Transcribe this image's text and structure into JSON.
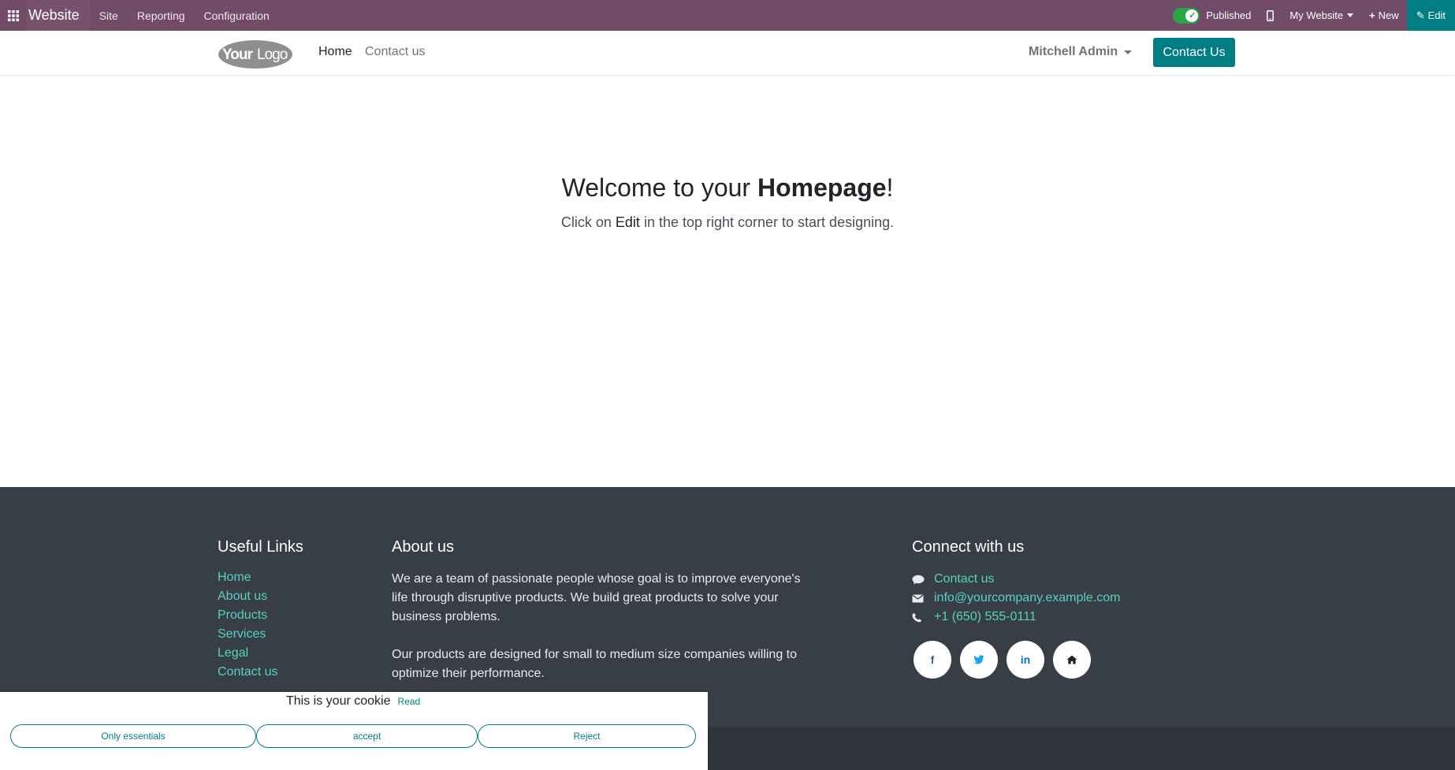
{
  "topbar": {
    "app_name": "Website",
    "menu": [
      "Site",
      "Reporting",
      "Configuration"
    ],
    "published_label": "Published",
    "website_label": "My Website",
    "new_label": "New",
    "edit_label": "Edit"
  },
  "header": {
    "logo_text": "YourLogo",
    "nav": [
      "Home",
      "Contact us"
    ],
    "user": "Mitchell Admin",
    "cta": "Contact Us"
  },
  "hero": {
    "title_pre": "Welcome to your ",
    "title_bold": "Homepage",
    "title_post": "!",
    "sub_pre": "Click on ",
    "sub_edit": "Edit",
    "sub_post": " in the top right corner to start designing."
  },
  "footer": {
    "useful_links_title": "Useful Links",
    "useful_links": [
      "Home",
      "About us",
      "Products",
      "Services",
      "Legal",
      "Contact us"
    ],
    "about_title": "About us",
    "about_p1": "We are a team of passionate people whose goal is to improve everyone's life through disruptive products. We build great products to solve your business problems.",
    "about_p2": "Our products are designed for small to medium size companies willing to optimize their performance.",
    "connect_title": "Connect with us",
    "connect_contact": "Contact us",
    "connect_email": "info@yourcompany.example.com",
    "connect_phone": "+1 (650) 555-0111",
    "socials": [
      "f",
      "t",
      "in",
      "home"
    ]
  },
  "cookie": {
    "text": "This is your cookie",
    "read": "Read",
    "buttons": [
      "Only essentials",
      "accept",
      "Reject"
    ]
  },
  "colors": {
    "admin_bar": "#714b67",
    "primary": "#017e84",
    "footer_bg": "#383e45",
    "footer_link": "#57d1c4"
  }
}
